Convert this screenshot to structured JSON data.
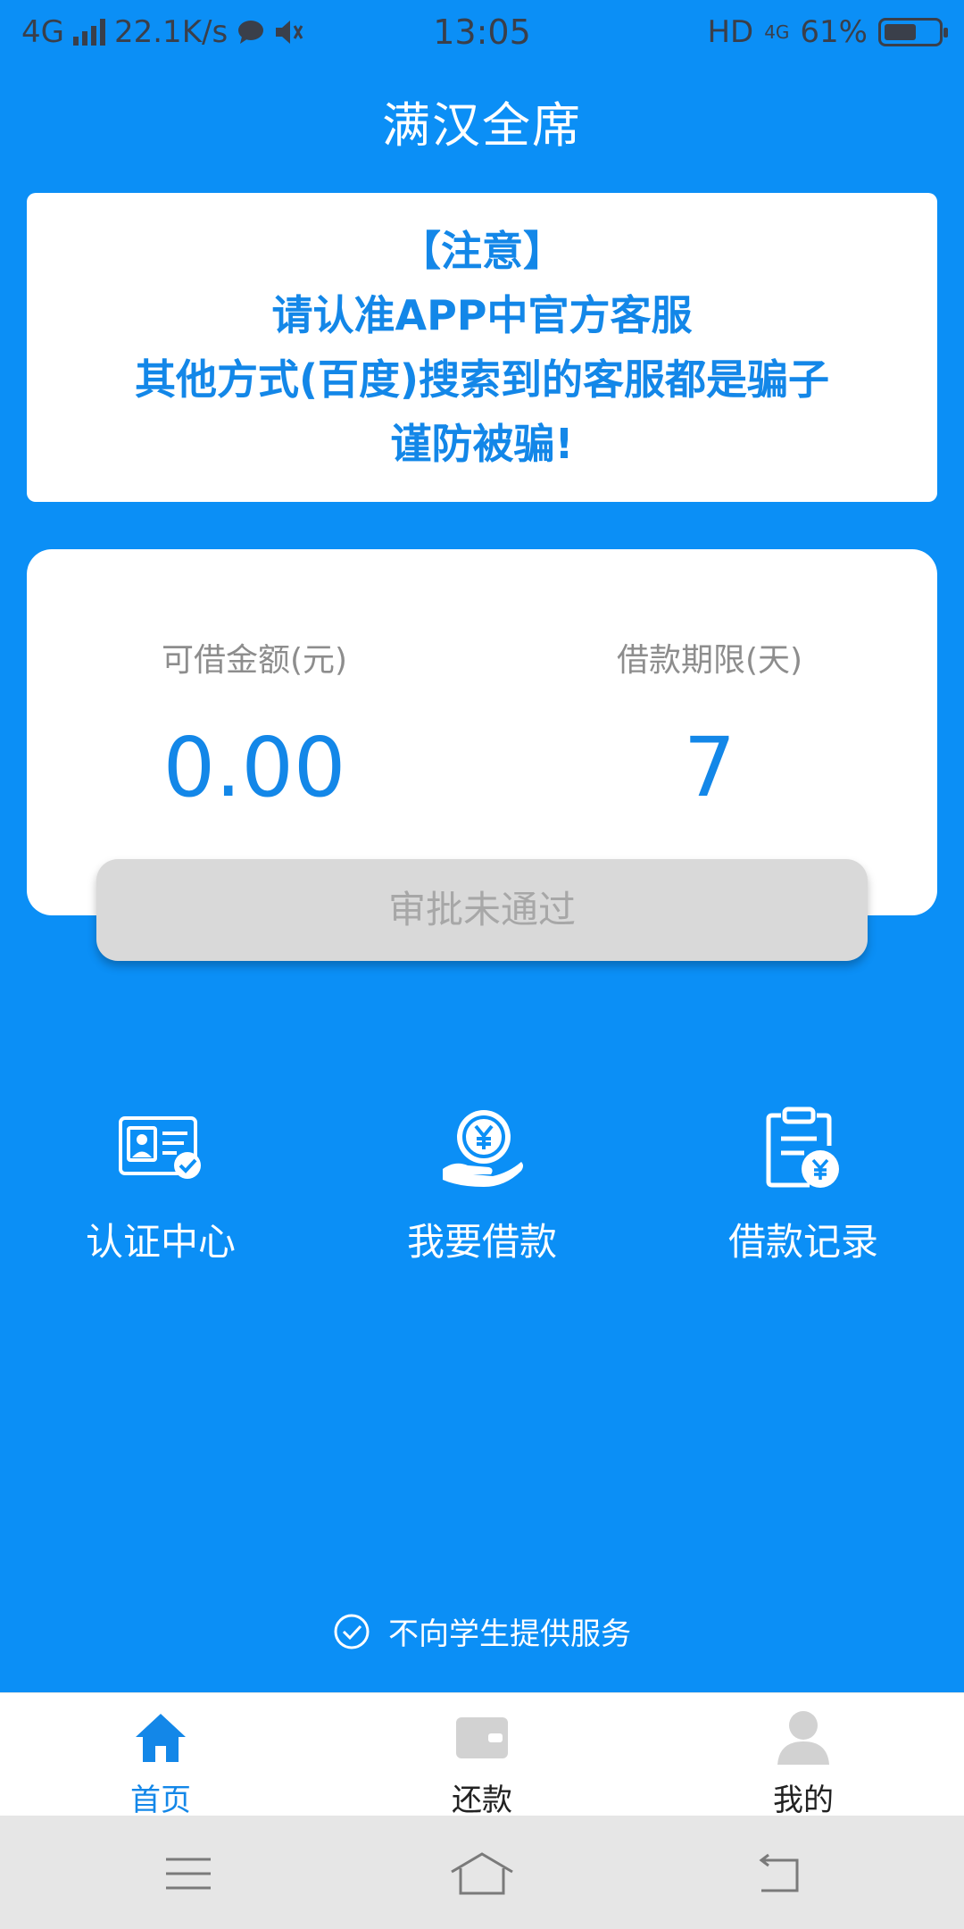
{
  "status": {
    "network": "4G",
    "speed": "22.1K/s",
    "time": "13:05",
    "hd": "HD",
    "net_right": "4G",
    "battery": "61%",
    "battery_fraction": 0.61
  },
  "app": {
    "title": "满汉全席"
  },
  "notice": {
    "line1": "【注意】",
    "line2": "请认准APP中官方客服",
    "line3": "其他方式(百度)搜索到的客服都是骗子",
    "line4": "谨防被骗!"
  },
  "loan": {
    "amount_label": "可借金额(元)",
    "amount_value": "0.00",
    "term_label": "借款期限(天)",
    "term_value": "7",
    "button_label": "审批未通过"
  },
  "features": [
    {
      "label": "认证中心",
      "icon": "id-card-check-icon"
    },
    {
      "label": "我要借款",
      "icon": "hand-coin-icon"
    },
    {
      "label": "借款记录",
      "icon": "clipboard-yen-icon"
    }
  ],
  "student_note": "不向学生提供服务",
  "tabs": [
    {
      "label": "首页",
      "icon": "home-icon",
      "active": true
    },
    {
      "label": "还款",
      "icon": "wallet-icon",
      "active": false
    },
    {
      "label": "我的",
      "icon": "user-icon",
      "active": false
    }
  ],
  "colors": {
    "primary": "#0b8ff6",
    "accent_text": "#1387e8",
    "button_disabled": "#d9d9d9"
  }
}
